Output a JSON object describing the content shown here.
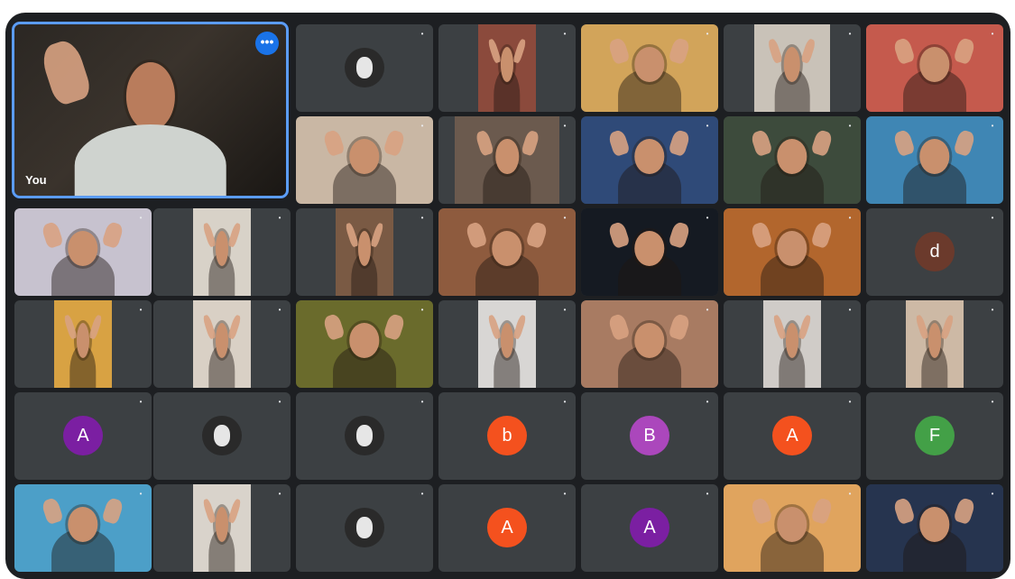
{
  "self_tile": {
    "name": "You",
    "more_options_icon": "more-horizontal-icon",
    "accent": "#1a73e8"
  },
  "tiles": [
    {
      "kind": "avatar-photo",
      "label": "",
      "bg": "#3c4043"
    },
    {
      "kind": "video",
      "label": "",
      "bg": "#8b4a3c",
      "w": 64
    },
    {
      "kind": "video",
      "label": "",
      "bg": "#d2a45a",
      "w": 150
    },
    {
      "kind": "video",
      "label": "",
      "bg": "#c9c2b8",
      "w": 84
    },
    {
      "kind": "video",
      "label": "",
      "bg": "#c55a4d",
      "w": 150
    },
    {
      "kind": "video",
      "label": "",
      "bg": "#c9b7a4",
      "w": 150
    },
    {
      "kind": "video",
      "label": "",
      "bg": "#6b5a4e",
      "w": 116
    },
    {
      "kind": "video",
      "label": "",
      "bg": "#2f4a78",
      "w": 150
    },
    {
      "kind": "video",
      "label": "",
      "bg": "#3d4b3c",
      "w": 150
    },
    {
      "kind": "video",
      "label": "",
      "bg": "#3f86b4",
      "w": 150
    },
    {
      "kind": "video",
      "label": "",
      "bg": "#c7c2cf",
      "w": 150
    },
    {
      "kind": "video",
      "label": "",
      "bg": "#d8d2c8",
      "w": 64
    },
    {
      "kind": "video",
      "label": "",
      "bg": "#7a5a44",
      "w": 64
    },
    {
      "kind": "video",
      "label": "",
      "bg": "#8e5b3e",
      "w": 150
    },
    {
      "kind": "video",
      "label": "",
      "bg": "#151a22",
      "w": 150
    },
    {
      "kind": "video",
      "label": "",
      "bg": "#b2662d",
      "w": 150
    },
    {
      "kind": "avatar-letter",
      "letter": "d",
      "color": "#6b3a2c",
      "pill": ""
    },
    {
      "kind": "video",
      "label": "",
      "bg": "#d8a243",
      "w": 64
    },
    {
      "kind": "video",
      "label": "",
      "bg": "#d9d0c5",
      "w": 64
    },
    {
      "kind": "video",
      "label": "",
      "bg": "#6a6b2c",
      "w": 150
    },
    {
      "kind": "video",
      "label": "",
      "bg": "#d8d6d4",
      "w": 64
    },
    {
      "kind": "video",
      "label": "",
      "bg": "#a87b62",
      "w": 150
    },
    {
      "kind": "video",
      "label": "",
      "bg": "#d0ccc8",
      "w": 64
    },
    {
      "kind": "video",
      "label": "",
      "bg": "#cdb9a5",
      "w": 64
    },
    {
      "kind": "avatar-letter",
      "letter": "A",
      "color": "#7b1fa2",
      "label": ""
    },
    {
      "kind": "avatar-photo",
      "label": ""
    },
    {
      "kind": "avatar-photo",
      "label": ""
    },
    {
      "kind": "avatar-letter",
      "letter": "b",
      "color": "#f4511e",
      "label": ""
    },
    {
      "kind": "avatar-letter",
      "letter": "B",
      "color": "#ab47bc",
      "label": ""
    },
    {
      "kind": "avatar-letter",
      "letter": "A",
      "color": "#f4511e",
      "label": ""
    },
    {
      "kind": "avatar-letter",
      "letter": "F",
      "color": "#43a047",
      "label": ""
    },
    {
      "kind": "video",
      "label": "",
      "bg": "#4c9fc8",
      "w": 150
    },
    {
      "kind": "video",
      "label": "",
      "bg": "#d9d3cb",
      "w": 64
    },
    {
      "kind": "avatar-photo",
      "label": ""
    },
    {
      "kind": "avatar-letter",
      "letter": "A",
      "color": "#f4511e",
      "label": ""
    },
    {
      "kind": "avatar-letter",
      "letter": "A",
      "color": "#7b1fa2",
      "label": ""
    },
    {
      "kind": "video",
      "label": "",
      "bg": "#e0a45e",
      "w": 150
    },
    {
      "kind": "video",
      "label": "",
      "bg": "#26344f",
      "w": 150
    }
  ]
}
